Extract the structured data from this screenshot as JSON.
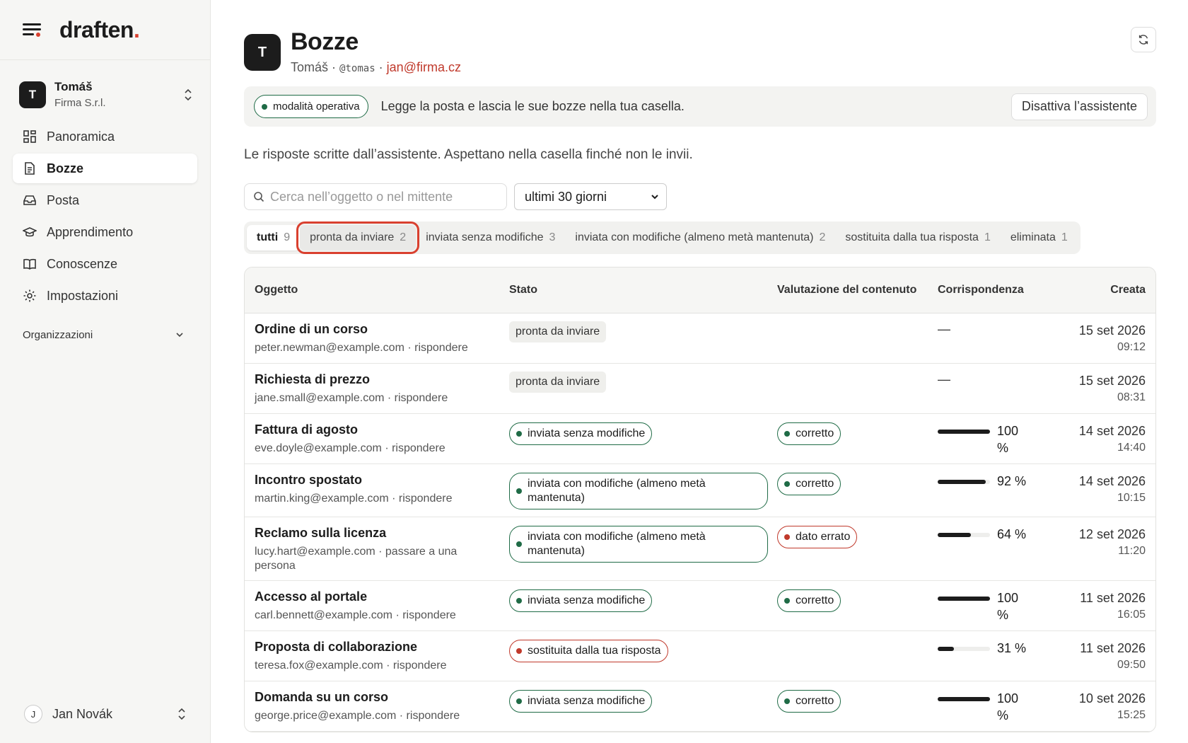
{
  "app": {
    "logo_text": "draften",
    "logo_dot": "."
  },
  "account": {
    "avatar_letter": "T",
    "name": "Tomáš",
    "org": "Firma S.r.l."
  },
  "nav": [
    {
      "label": "Panoramica",
      "icon": "grid-icon",
      "active": false
    },
    {
      "label": "Bozze",
      "icon": "document-icon",
      "active": true
    },
    {
      "label": "Posta",
      "icon": "inbox-icon",
      "active": false
    },
    {
      "label": "Apprendimento",
      "icon": "graduation-cap-icon",
      "active": false
    },
    {
      "label": "Conoscenze",
      "icon": "book-icon",
      "active": false
    },
    {
      "label": "Impostazioni",
      "icon": "gear-icon",
      "active": false
    }
  ],
  "nav_section": {
    "label": "Organizzazioni"
  },
  "footer_user": {
    "avatar_letter": "J",
    "name": "Jan Novák"
  },
  "header": {
    "avatar_letter": "T",
    "title": "Bozze",
    "name": "Tomáš",
    "sep": "·",
    "handle": "@tomas",
    "email": "jan@firma.cz"
  },
  "banner": {
    "mode_label": "modalità operativa",
    "text": "Legge la posta e lascia le sue bozze nella tua casella.",
    "button": "Disattiva l’assistente"
  },
  "intro": "Le risposte scritte dall’assistente. Aspettano nella casella finché non le invii.",
  "search": {
    "placeholder": "Cerca nell’oggetto o nel mittente"
  },
  "period": {
    "selected": "ultimi 30 giorni"
  },
  "tabs": [
    {
      "label": "tutti",
      "count": "9"
    },
    {
      "label": "pronta da inviare",
      "count": "2"
    },
    {
      "label": "inviata senza modifiche",
      "count": "3"
    },
    {
      "label": "inviata con modifiche (almeno metà mantenuta)",
      "count": "2"
    },
    {
      "label": "sostituita dalla tua risposta",
      "count": "1"
    },
    {
      "label": "eliminata",
      "count": "1"
    }
  ],
  "table": {
    "headers": {
      "subject": "Oggetto",
      "status": "Stato",
      "rating": "Valutazione del contenuto",
      "match": "Corrispondenza",
      "created": "Creata"
    },
    "rows": [
      {
        "subject": "Ordine di un corso",
        "meta": "peter.newman@example.com · rispondere",
        "status": "pronta da inviare",
        "status_style": "plain",
        "rating": "",
        "rating_style": "",
        "match_value": null,
        "match_text": "—",
        "date": "15 set 2026",
        "time": "09:12"
      },
      {
        "subject": "Richiesta di prezzo",
        "meta": "jane.small@example.com · rispondere",
        "status": "pronta da inviare",
        "status_style": "plain",
        "rating": "",
        "rating_style": "",
        "match_value": null,
        "match_text": "—",
        "date": "15 set 2026",
        "time": "08:31"
      },
      {
        "subject": "Fattura di agosto",
        "meta": "eve.doyle@example.com · rispondere",
        "status": "inviata senza modifiche",
        "status_style": "green",
        "rating": "corretto",
        "rating_style": "green",
        "match_value": 100,
        "match_text": "100 %",
        "date": "14 set 2026",
        "time": "14:40"
      },
      {
        "subject": "Incontro spostato",
        "meta": "martin.king@example.com · rispondere",
        "status": "inviata con modifiche (almeno metà mantenuta)",
        "status_style": "green-multi",
        "rating": "corretto",
        "rating_style": "green",
        "match_value": 92,
        "match_text": "92 %",
        "date": "14 set 2026",
        "time": "10:15"
      },
      {
        "subject": "Reclamo sulla licenza",
        "meta": "lucy.hart@example.com · passare a una persona",
        "status": "inviata con modifiche (almeno metà mantenuta)",
        "status_style": "green-multi",
        "rating": "dato errato",
        "rating_style": "red",
        "match_value": 64,
        "match_text": "64 %",
        "date": "12 set 2026",
        "time": "11:20"
      },
      {
        "subject": "Accesso al portale",
        "meta": "carl.bennett@example.com · rispondere",
        "status": "inviata senza modifiche",
        "status_style": "green",
        "rating": "corretto",
        "rating_style": "green",
        "match_value": 100,
        "match_text": "100 %",
        "date": "11 set 2026",
        "time": "16:05"
      },
      {
        "subject": "Proposta di collaborazione",
        "meta": "teresa.fox@example.com · rispondere",
        "status": "sostituita dalla tua risposta",
        "status_style": "red",
        "rating": "",
        "rating_style": "",
        "match_value": 31,
        "match_text": "31 %",
        "date": "11 set 2026",
        "time": "09:50"
      },
      {
        "subject": "Domanda su un corso",
        "meta": "george.price@example.com · rispondere",
        "status": "inviata senza modifiche",
        "status_style": "green",
        "rating": "corretto",
        "rating_style": "green",
        "match_value": 100,
        "match_text": "100 %",
        "date": "10 set 2026",
        "time": "15:25"
      }
    ]
  },
  "colors": {
    "accent": "#d9402f",
    "green": "#1f6b46",
    "red": "#c0392b"
  }
}
